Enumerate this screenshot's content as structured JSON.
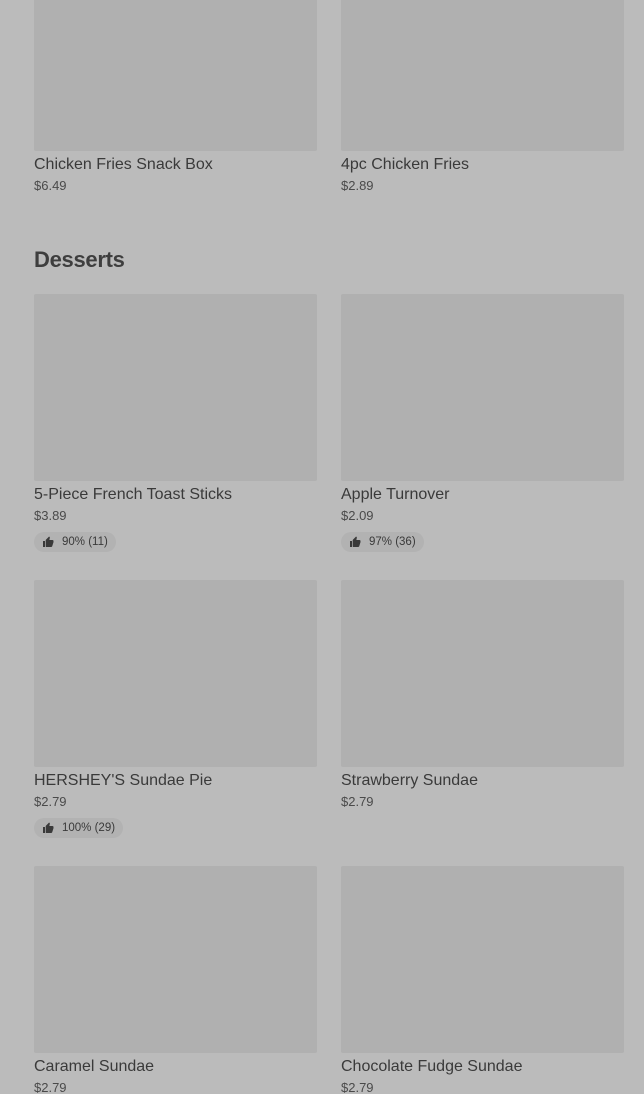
{
  "top_items": [
    {
      "name": "Chicken Fries Snack Box",
      "price": "$6.49"
    },
    {
      "name": "4pc Chicken Fries",
      "price": "$2.89"
    }
  ],
  "desserts": {
    "title": "Desserts",
    "items": [
      {
        "name": "5-Piece French Toast Sticks",
        "price": "$3.89",
        "rating": "90% (11)"
      },
      {
        "name": "Apple Turnover",
        "price": "$2.09",
        "rating": "97% (36)"
      },
      {
        "name": "HERSHEY'S Sundae Pie",
        "price": "$2.79",
        "rating": "100% (29)"
      },
      {
        "name": "Strawberry Sundae",
        "price": "$2.79"
      },
      {
        "name": "Caramel Sundae",
        "price": "$2.79"
      },
      {
        "name": "Chocolate Fudge Sundae",
        "price": "$2.79"
      }
    ]
  },
  "icons": {
    "rating": "thumbs-up-icon"
  },
  "colors": {
    "background": "#bbbbbb",
    "image_placeholder": "#b0b0b0",
    "rating_pill": "#b2b2b2",
    "text": "#3a3a3a"
  }
}
